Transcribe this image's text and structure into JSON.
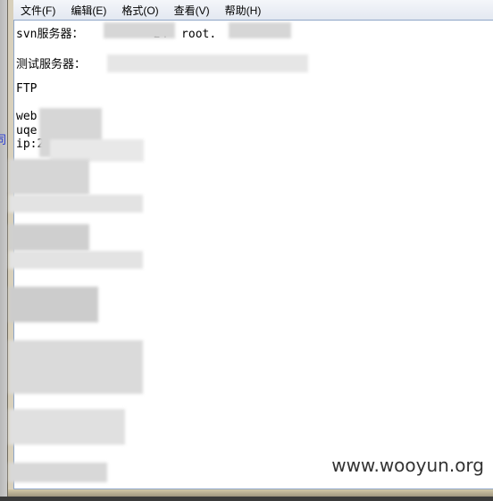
{
  "menu": [
    "文件(F)",
    "编辑(E)",
    "格式(O)",
    "查看(V)",
    "帮助(H)"
  ],
  "background_char": "同",
  "lines": {
    "svn": "svn服务器：          24  root.",
    "test": "测试服务器：",
    "ftp": "FTP",
    "web": "web",
    "uqe": "uqe",
    "ip": "ip:2"
  },
  "watermark": "www.wooyun.org"
}
